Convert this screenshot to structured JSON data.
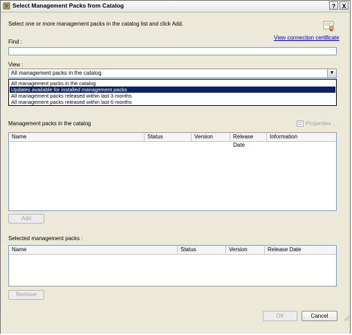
{
  "window": {
    "title": "Select Management Packs from Catalog",
    "help_label": "?",
    "close_label": "X"
  },
  "instruction": "Select one or more management packs in the catalog list and click Add.",
  "certificate_link": "View connection certificate",
  "find": {
    "label": "Find :",
    "value": ""
  },
  "view": {
    "label": "View :",
    "selected": "All management packs in the catalog",
    "options": [
      "All management packs in the catalog",
      "Updates available for installed management packs",
      "All management packs released within last 3 months",
      "All management packs released within last 6 months"
    ],
    "highlighted_option": "Updates available for installed management packs"
  },
  "catalog": {
    "label": "Management packs in the catalog",
    "properties_label": "Properties ...",
    "columns": [
      "Name",
      "Status",
      "Version",
      "Release Date",
      "Information"
    ]
  },
  "add_button": "Add",
  "selected": {
    "label": "Selected management packs :",
    "columns": [
      "Name",
      "Status",
      "Version",
      "Release Date"
    ]
  },
  "remove_button": "Remove",
  "ok_button": "OK",
  "cancel_button": "Cancel",
  "colors": {
    "dialog_background": "#ece9d8",
    "selection_highlight": "#0a246a",
    "link": "#0000cc"
  }
}
